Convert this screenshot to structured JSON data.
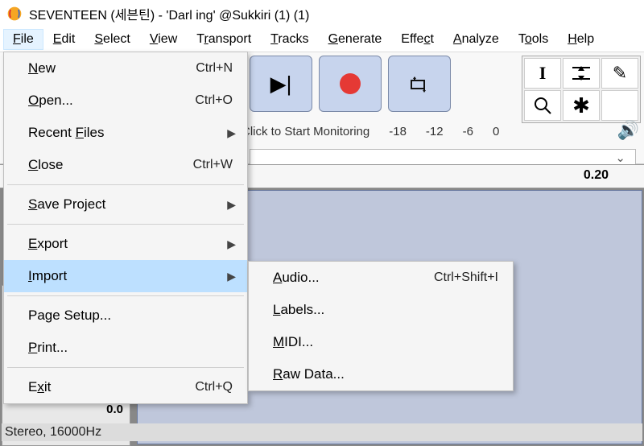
{
  "title": "SEVENTEEN (세븐틴) - 'Darl ing' @Sukkiri (1) (1)",
  "menubar": {
    "file": "File",
    "edit": "Edit",
    "select": "Select",
    "view": "View",
    "transport": "Transport",
    "tracks": "Tracks",
    "generate": "Generate",
    "effect": "Effect",
    "analyze": "Analyze",
    "tools": "Tools",
    "help": "Help"
  },
  "file_menu": {
    "new": "New",
    "new_sc": "Ctrl+N",
    "open": "Open...",
    "open_sc": "Ctrl+O",
    "recent": "Recent Files",
    "close": "Close",
    "close_sc": "Ctrl+W",
    "save_project": "Save Project",
    "export": "Export",
    "import": "Import",
    "page_setup": "Page Setup...",
    "print": "Print...",
    "exit": "Exit",
    "exit_sc": "Ctrl+Q"
  },
  "import_menu": {
    "audio": "Audio...",
    "audio_sc": "Ctrl+Shift+I",
    "labels": "Labels...",
    "midi": "MIDI...",
    "raw": "Raw Data..."
  },
  "meter": {
    "click_label": "Click to Start Monitoring",
    "t1": "-18",
    "t2": "-12",
    "t3": "-6",
    "t4": "0"
  },
  "ruler": {
    "mark": "0.20"
  },
  "track": {
    "zero": "0.0",
    "info": "Stereo, 16000Hz"
  },
  "icons": {
    "skip_end": "▶|",
    "loop": "⟲",
    "ibeam": "I",
    "env": "⫞",
    "pencil": "✎",
    "zoom": "Q",
    "star": "✱",
    "speaker": "🔊",
    "chev": "⌄",
    "sub_arrow": "▶"
  }
}
